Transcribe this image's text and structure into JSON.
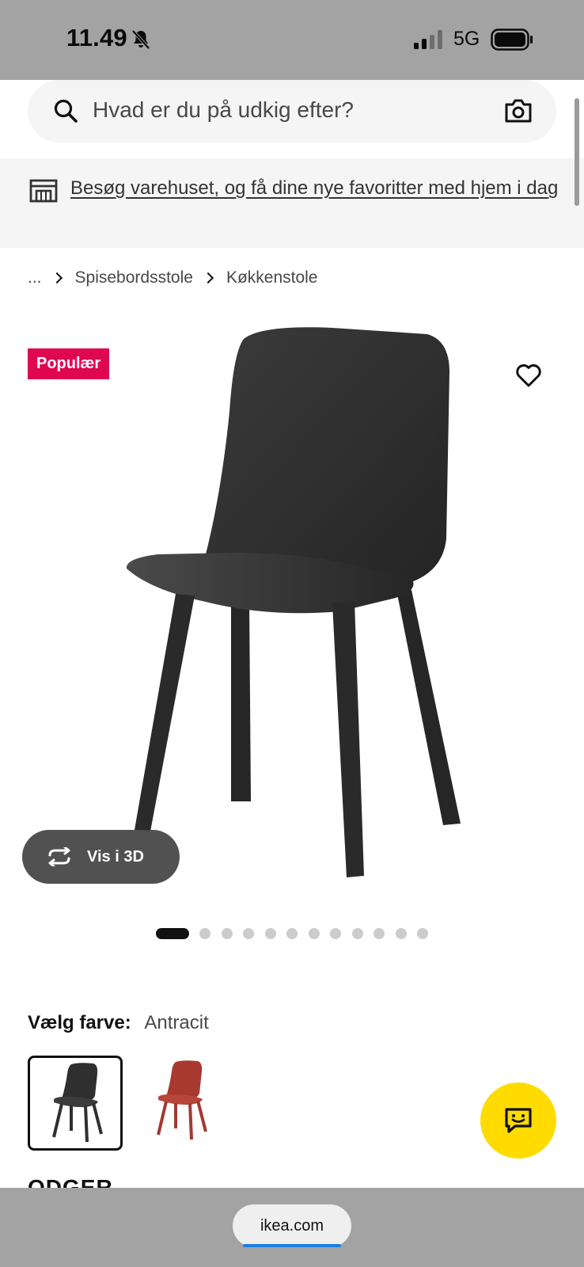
{
  "status_bar": {
    "time": "11.49",
    "network": "5G"
  },
  "search": {
    "placeholder": "Hvad er du på udkig efter?"
  },
  "store_banner": {
    "text": "Besøg varehuset, og få dine nye favoritter med hjem i dag"
  },
  "breadcrumb": {
    "items": [
      "...",
      "Spisebordsstole",
      "Køkkenstole"
    ]
  },
  "product": {
    "badge": "Populær",
    "view_3d_label": "Vis i 3D",
    "image_count": 12,
    "active_image_index": 0,
    "color_label": "Vælg farve:",
    "color_value": "Antracit",
    "swatches": [
      {
        "name": "Antracit",
        "color": "#2e2e2e",
        "selected": true
      },
      {
        "name": "Rød",
        "color": "#a8392f",
        "selected": false
      }
    ],
    "name": "ODGER"
  },
  "colors": {
    "badge_bg": "#e00751",
    "chat_bg": "#ffdb00",
    "chair": "#2f2f30"
  },
  "browser": {
    "url": "ikea.com"
  }
}
